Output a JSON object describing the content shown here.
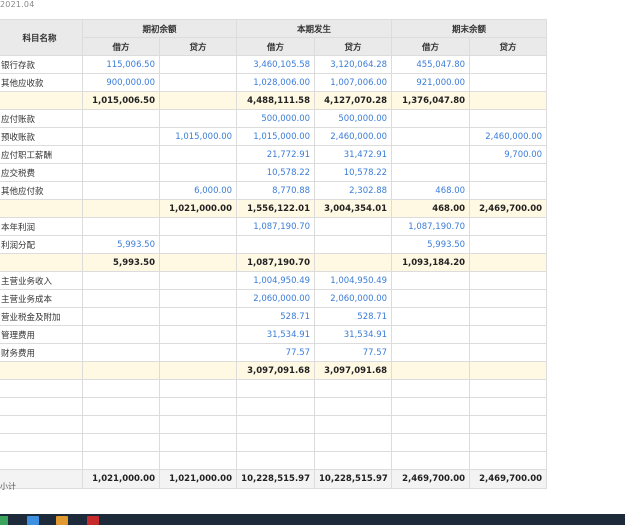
{
  "header": {
    "period": "2021.04"
  },
  "table": {
    "col_name": "科目名称",
    "groups": [
      "期初余额",
      "本期发生",
      "期末余额"
    ],
    "debit": "借方",
    "credit": "贷方",
    "rows": [
      {
        "type": "item",
        "name": "银行存款",
        "v": [
          "115,006.50",
          "",
          "3,460,105.58",
          "3,120,064.28",
          "455,047.80",
          ""
        ]
      },
      {
        "type": "item",
        "name": "其他应收款",
        "v": [
          "900,000.00",
          "",
          "1,028,006.00",
          "1,007,006.00",
          "921,000.00",
          ""
        ]
      },
      {
        "type": "sub",
        "name": "",
        "v": [
          "1,015,006.50",
          "",
          "4,488,111.58",
          "4,127,070.28",
          "1,376,047.80",
          ""
        ]
      },
      {
        "type": "item",
        "name": "应付账款",
        "v": [
          "",
          "",
          "500,000.00",
          "500,000.00",
          "",
          ""
        ]
      },
      {
        "type": "item",
        "name": "预收账款",
        "v": [
          "",
          "1,015,000.00",
          "1,015,000.00",
          "2,460,000.00",
          "",
          "2,460,000.00"
        ]
      },
      {
        "type": "item",
        "name": "应付职工薪酬",
        "v": [
          "",
          "",
          "21,772.91",
          "31,472.91",
          "",
          "9,700.00"
        ]
      },
      {
        "type": "item",
        "name": "应交税费",
        "v": [
          "",
          "",
          "10,578.22",
          "10,578.22",
          "",
          ""
        ]
      },
      {
        "type": "item",
        "name": "其他应付款",
        "v": [
          "",
          "6,000.00",
          "8,770.88",
          "2,302.88",
          "468.00",
          ""
        ]
      },
      {
        "type": "sub",
        "name": "",
        "v": [
          "",
          "1,021,000.00",
          "1,556,122.01",
          "3,004,354.01",
          "468.00",
          "2,469,700.00"
        ]
      },
      {
        "type": "item",
        "name": "本年利润",
        "v": [
          "",
          "",
          "1,087,190.70",
          "",
          "1,087,190.70",
          ""
        ]
      },
      {
        "type": "item",
        "name": "利润分配",
        "v": [
          "5,993.50",
          "",
          "",
          "",
          "5,993.50",
          ""
        ]
      },
      {
        "type": "sub",
        "name": "",
        "v": [
          "5,993.50",
          "",
          "1,087,190.70",
          "",
          "1,093,184.20",
          ""
        ]
      },
      {
        "type": "item",
        "name": "主营业务收入",
        "v": [
          "",
          "",
          "1,004,950.49",
          "1,004,950.49",
          "",
          ""
        ]
      },
      {
        "type": "item",
        "name": "主营业务成本",
        "v": [
          "",
          "",
          "2,060,000.00",
          "2,060,000.00",
          "",
          ""
        ]
      },
      {
        "type": "item",
        "name": "营业税金及附加",
        "v": [
          "",
          "",
          "528.71",
          "528.71",
          "",
          ""
        ]
      },
      {
        "type": "item",
        "name": "管理费用",
        "v": [
          "",
          "",
          "31,534.91",
          "31,534.91",
          "",
          ""
        ]
      },
      {
        "type": "item",
        "name": "财务费用",
        "v": [
          "",
          "",
          "77.57",
          "77.57",
          "",
          ""
        ]
      },
      {
        "type": "sub",
        "name": "",
        "v": [
          "",
          "",
          "3,097,091.68",
          "3,097,091.68",
          "",
          ""
        ]
      },
      {
        "type": "blank",
        "name": "",
        "v": [
          "",
          "",
          "",
          "",
          "",
          ""
        ]
      },
      {
        "type": "blank",
        "name": "",
        "v": [
          "",
          "",
          "",
          "",
          "",
          ""
        ]
      },
      {
        "type": "blank",
        "name": "",
        "v": [
          "",
          "",
          "",
          "",
          "",
          ""
        ]
      },
      {
        "type": "blank",
        "name": "",
        "v": [
          "",
          "",
          "",
          "",
          "",
          ""
        ]
      },
      {
        "type": "blank",
        "name": "",
        "v": [
          "",
          "",
          "",
          "",
          "",
          ""
        ]
      },
      {
        "type": "total",
        "name": "",
        "v": [
          "1,021,000.00",
          "1,021,000.00",
          "10,228,515.97",
          "10,228,515.97",
          "2,469,700.00",
          "2,469,700.00"
        ]
      }
    ]
  },
  "footer": {
    "text": "小计"
  }
}
